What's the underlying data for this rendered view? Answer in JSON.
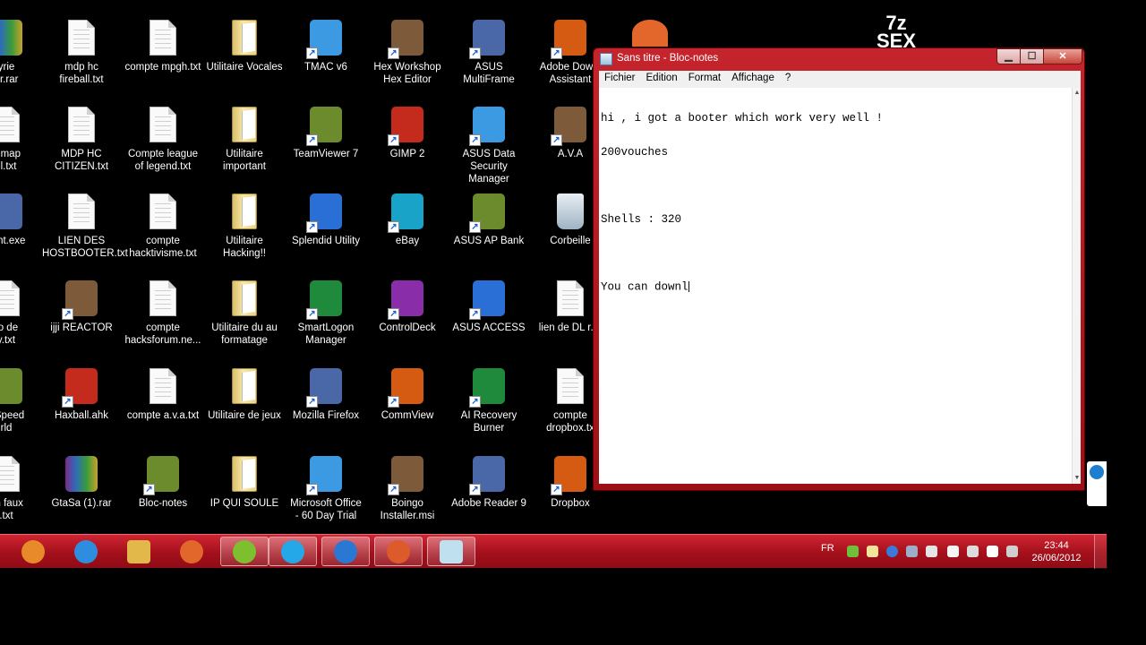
{
  "desktop": {
    "icons": [
      {
        "label": "yrie\nbr.rar",
        "type": "rar"
      },
      {
        "label": "mdp hc\nfireball.txt",
        "type": "txt"
      },
      {
        "label": "compte mpgh.txt",
        "type": "txt"
      },
      {
        "label": "Utilitaire Vocales",
        "type": "folder"
      },
      {
        "label": "TMAC v6",
        "type": "app"
      },
      {
        "label": "Hex Workshop\nHex Editor",
        "type": "app"
      },
      {
        "label": "ASUS MultiFrame",
        "type": "app"
      },
      {
        "label": "Adobe Downl\nAssistant",
        "type": "app"
      },
      {
        "label": "d map\nill.txt",
        "type": "txt"
      },
      {
        "label": "MDP HC\nCITIZEN.txt",
        "type": "txt"
      },
      {
        "label": "Compte league\nof legend.txt",
        "type": "txt"
      },
      {
        "label": "Utilitaire\nimportant",
        "type": "folder"
      },
      {
        "label": "TeamViewer 7",
        "type": "app"
      },
      {
        "label": "GIMP 2",
        "type": "app"
      },
      {
        "label": "ASUS Data\nSecurity Manager",
        "type": "app"
      },
      {
        "label": "A.V.A",
        "type": "app"
      },
      {
        "label": "lient.exe",
        "type": "app"
      },
      {
        "label": "LIEN DES\nHOSTBOOTER.txt",
        "type": "txt"
      },
      {
        "label": "compte\nhacktivisme.txt",
        "type": "txt"
      },
      {
        "label": "Utilitaire\nHacking!!",
        "type": "folder"
      },
      {
        "label": "Splendid Utility",
        "type": "app"
      },
      {
        "label": "eBay",
        "type": "app"
      },
      {
        "label": "ASUS AP Bank",
        "type": "app"
      },
      {
        "label": "Corbeille",
        "type": "bin"
      },
      {
        "label": "ro de\ny.txt",
        "type": "txt"
      },
      {
        "label": "ijji REACTOR",
        "type": "app"
      },
      {
        "label": "compte\nhacksforum.ne...",
        "type": "txt"
      },
      {
        "label": "Utilitaire du au\nformatage",
        "type": "folder"
      },
      {
        "label": "SmartLogon\nManager",
        "type": "app"
      },
      {
        "label": "ControlDeck",
        "type": "app"
      },
      {
        "label": "ASUS ACCESS",
        "type": "app"
      },
      {
        "label": "lien de DL r.a.",
        "type": "txt"
      },
      {
        "label": "r Speed\nrld",
        "type": "app"
      },
      {
        "label": "Haxball.ahk",
        "type": "app"
      },
      {
        "label": "compte a.v.a.txt",
        "type": "txt"
      },
      {
        "label": "Utilitaire de jeux",
        "type": "folder"
      },
      {
        "label": "Mozilla Firefox",
        "type": "app"
      },
      {
        "label": "CommView",
        "type": "app"
      },
      {
        "label": "AI Recovery\nBurner",
        "type": "app"
      },
      {
        "label": "compte\ndropbox.tx",
        "type": "txt"
      },
      {
        "label": "un faux\n.txt",
        "type": "txt"
      },
      {
        "label": "GtaSa (1).rar",
        "type": "rar"
      },
      {
        "label": "Bloc-notes",
        "type": "app"
      },
      {
        "label": "IP QUI SOULE",
        "type": "folder"
      },
      {
        "label": "Microsoft Office\n- 60 Day Trial",
        "type": "app"
      },
      {
        "label": "Boingo\nInstaller.msi",
        "type": "app"
      },
      {
        "label": "Adobe Reader 9",
        "type": "app"
      },
      {
        "label": "Dropbox",
        "type": "app"
      }
    ],
    "partial_top": "7z\nSEX"
  },
  "notepad": {
    "title": "Sans titre - Bloc-notes",
    "menu": [
      "Fichier",
      "Edition",
      "Format",
      "Affichage",
      "?"
    ],
    "lines": [
      "hi , i got a booter which work very well !",
      "200vouches",
      "",
      "Shells : 320",
      "",
      "You can downl"
    ]
  },
  "taskbar": {
    "items": [
      "Windows Media Player",
      "Internet Explorer",
      "Explorateur Windows",
      "Firefox",
      "Utorrent",
      "Skype",
      "TeamViewer",
      "HFS",
      "Bloc-notes"
    ],
    "tray": {
      "language": "FR",
      "time": "23:44",
      "date": "26/06/2012"
    }
  },
  "colors": {
    "taskbar": "#b5141f",
    "window_frame": "#b91e26"
  }
}
